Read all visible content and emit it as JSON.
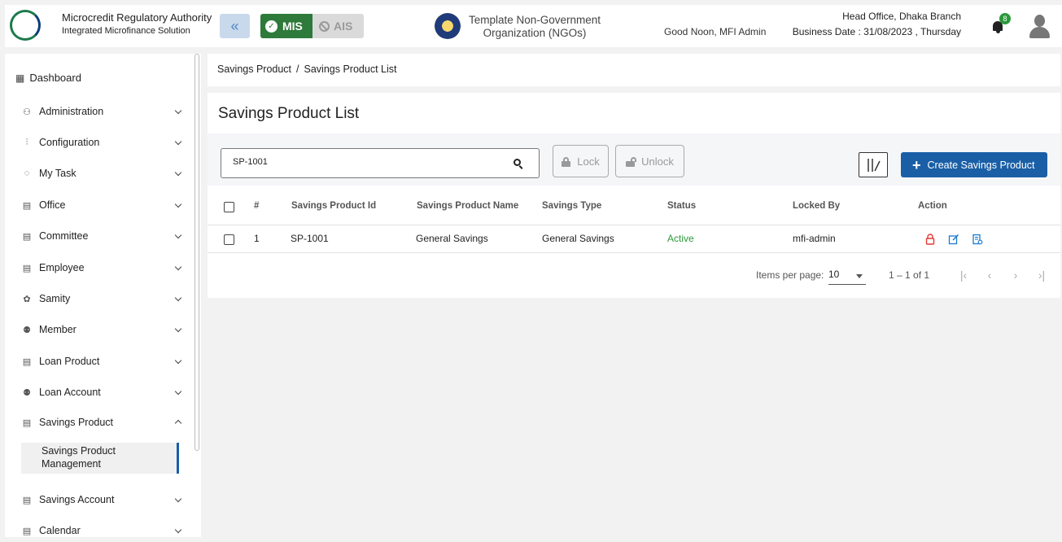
{
  "header": {
    "logo_text": "Microcredit Regulatory Authority",
    "org_name": "Microcredit Regulatory Authority",
    "org_sub": "Integrated Microfinance Solution",
    "mis_label": "MIS",
    "ais_label": "AIS",
    "ngo_name": "Template Non-Government Organization (NGOs)",
    "greeting": "Good Noon, MFI Admin",
    "branch": "Head Office, Dhaka Branch",
    "business_date": "Business Date : 31/08/2023 , Thursday",
    "notification_count": "8",
    "colors": {
      "brand_blue": "#1a5fa6",
      "mis_green": "#2e7a3a"
    }
  },
  "sidebar": {
    "dashboard": "Dashboard",
    "items": [
      {
        "label": "Administration",
        "icon": "admin-icon"
      },
      {
        "label": "Configuration",
        "icon": "sliders-icon"
      },
      {
        "label": "My Task",
        "icon": "task-icon"
      },
      {
        "label": "Office",
        "icon": "office-icon"
      },
      {
        "label": "Committee",
        "icon": "committee-icon"
      },
      {
        "label": "Employee",
        "icon": "employee-icon"
      },
      {
        "label": "Samity",
        "icon": "samity-icon"
      },
      {
        "label": "Member",
        "icon": "member-icon"
      },
      {
        "label": "Loan Product",
        "icon": "loan-product-icon"
      },
      {
        "label": "Loan Account",
        "icon": "loan-account-icon"
      },
      {
        "label": "Savings Product",
        "icon": "savings-product-icon"
      },
      {
        "label": "Savings Account",
        "icon": "savings-account-icon"
      },
      {
        "label": "Calendar",
        "icon": "calendar-icon"
      }
    ],
    "active_sub": "Savings Product Management"
  },
  "breadcrumb": {
    "parent": "Savings Product",
    "separator": "/",
    "current": "Savings Product List"
  },
  "main": {
    "title": "Savings Product List",
    "search_value": "SP-1001",
    "lock_label": "Lock",
    "unlock_label": "Unlock",
    "create_label": "Create Savings Product"
  },
  "table": {
    "headers": [
      "#",
      "Savings Product Id",
      "Savings Product Name",
      "Savings Type",
      "Status",
      "Locked By",
      "Action"
    ],
    "rows": [
      {
        "num": "1",
        "id": "SP-1001",
        "name": "General Savings",
        "type": "General Savings",
        "status": "Active",
        "locked_by": "mfi-admin"
      }
    ]
  },
  "paginator": {
    "items_per_page_label": "Items per page:",
    "items_per_page": "10",
    "range": "1 – 1 of 1"
  }
}
